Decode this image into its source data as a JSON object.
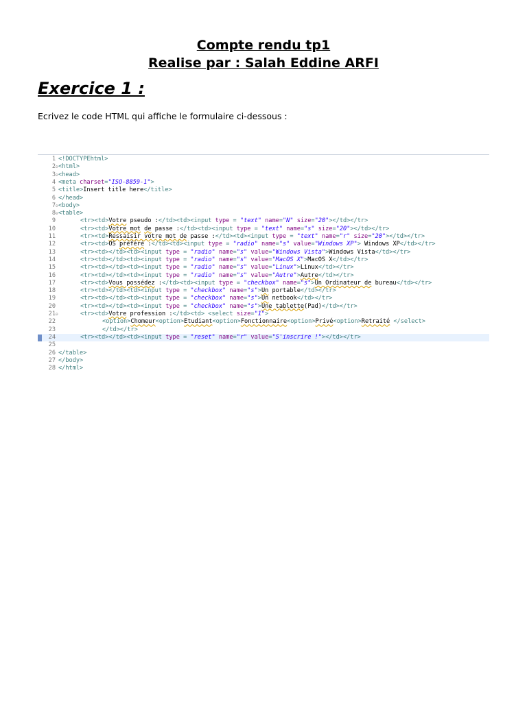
{
  "header": {
    "title_line1": "Compte rendu tp1",
    "title_line2": "Realise par : Salah Eddine ARFI"
  },
  "exercise": {
    "heading": "Exercice 1 :",
    "instruction": "Ecrivez le code HTML qui affiche le formulaire ci-dessous :"
  },
  "code_editor": {
    "current_line": 24,
    "lines": [
      {
        "n": "1",
        "fold": false,
        "indent": 0,
        "tokens": [
          [
            "tag",
            "<!DOCTYPE"
          ],
          [
            "tag",
            "html"
          ],
          [
            "tag",
            ">"
          ]
        ]
      },
      {
        "n": "2",
        "fold": true,
        "indent": 0,
        "tokens": [
          [
            "tag",
            "<html>"
          ]
        ]
      },
      {
        "n": "3",
        "fold": true,
        "indent": 0,
        "tokens": [
          [
            "tag",
            "<head>"
          ]
        ]
      },
      {
        "n": "4",
        "fold": false,
        "indent": 0,
        "tokens": [
          [
            "tag",
            "<meta "
          ],
          [
            "attr",
            "charset"
          ],
          [
            "tag",
            "="
          ],
          [
            "val",
            "\"ISO-8859-1\""
          ],
          [
            "tag",
            ">"
          ]
        ]
      },
      {
        "n": "5",
        "fold": false,
        "indent": 0,
        "tokens": [
          [
            "tag",
            "<title>"
          ],
          [
            "txt",
            "Insert title here"
          ],
          [
            "tag",
            "</title>"
          ]
        ]
      },
      {
        "n": "6",
        "fold": false,
        "indent": 0,
        "tokens": [
          [
            "tag",
            "</head>"
          ]
        ]
      },
      {
        "n": "7",
        "fold": true,
        "indent": 0,
        "tokens": [
          [
            "tag",
            "<body>"
          ]
        ]
      },
      {
        "n": "8",
        "fold": true,
        "indent": 0,
        "tokens": [
          [
            "tag",
            "<table>"
          ]
        ]
      },
      {
        "n": "9",
        "fold": false,
        "indent": 1,
        "tokens": [
          [
            "tag",
            "<tr><td>"
          ],
          [
            "sq",
            "Votre"
          ],
          [
            "txt",
            " pseudo :"
          ],
          [
            "tag",
            "</td><td><input "
          ],
          [
            "attr",
            "type"
          ],
          [
            "tag",
            " = "
          ],
          [
            "val",
            "\"text\""
          ],
          [
            "attr",
            " name"
          ],
          [
            "tag",
            "="
          ],
          [
            "val",
            "\"N\""
          ],
          [
            "attr",
            " size"
          ],
          [
            "tag",
            "="
          ],
          [
            "val",
            "\"20\""
          ],
          [
            "tag",
            "></td></tr>"
          ]
        ]
      },
      {
        "n": "10",
        "fold": false,
        "indent": 1,
        "tokens": [
          [
            "tag",
            "<tr><td>"
          ],
          [
            "sq",
            "Votre mot"
          ],
          [
            "txt",
            " "
          ],
          [
            "sq",
            "de"
          ],
          [
            "txt",
            " passe :"
          ],
          [
            "tag",
            "</td><td><input "
          ],
          [
            "attr",
            "type"
          ],
          [
            "tag",
            " = "
          ],
          [
            "val",
            "\"text\""
          ],
          [
            "attr",
            " name"
          ],
          [
            "tag",
            "="
          ],
          [
            "val",
            "\"s\""
          ],
          [
            "attr",
            " size"
          ],
          [
            "tag",
            "="
          ],
          [
            "val",
            "\"20\""
          ],
          [
            "tag",
            "></td></tr>"
          ]
        ]
      },
      {
        "n": "11",
        "fold": false,
        "indent": 1,
        "tokens": [
          [
            "tag",
            "<tr><td>"
          ],
          [
            "sq",
            "Ressaisir votre mot de"
          ],
          [
            "txt",
            " passe :"
          ],
          [
            "tag",
            "</td><td><input "
          ],
          [
            "attr",
            "type"
          ],
          [
            "tag",
            " = "
          ],
          [
            "val",
            "\"text\""
          ],
          [
            "attr",
            " name"
          ],
          [
            "tag",
            "="
          ],
          [
            "val",
            "\"r\""
          ],
          [
            "attr",
            " size"
          ],
          [
            "tag",
            "="
          ],
          [
            "val",
            "\"20\""
          ],
          [
            "tag",
            "></td></tr>"
          ]
        ]
      },
      {
        "n": "12",
        "fold": false,
        "indent": 1,
        "tokens": [
          [
            "tag",
            "<tr><td>"
          ],
          [
            "txt",
            "OS "
          ],
          [
            "sq",
            "préféré"
          ],
          [
            "txt",
            " :"
          ],
          [
            "tag",
            "</td><td><input "
          ],
          [
            "attr",
            "type"
          ],
          [
            "tag",
            " = "
          ],
          [
            "val",
            "\"radio\""
          ],
          [
            "attr",
            " name"
          ],
          [
            "tag",
            "="
          ],
          [
            "val",
            "\"s\""
          ],
          [
            "attr",
            " value"
          ],
          [
            "tag",
            "="
          ],
          [
            "val",
            "\"Windows XP\""
          ],
          [
            "tag",
            "> "
          ],
          [
            "txt",
            "Windows XP"
          ],
          [
            "tag",
            "</td></tr>"
          ]
        ]
      },
      {
        "n": "13",
        "fold": false,
        "indent": 1,
        "tokens": [
          [
            "tag",
            "<tr><td></td><td><input "
          ],
          [
            "attr",
            "type"
          ],
          [
            "tag",
            " = "
          ],
          [
            "val",
            "\"radio\""
          ],
          [
            "attr",
            " name"
          ],
          [
            "tag",
            "="
          ],
          [
            "val",
            "\"s\""
          ],
          [
            "attr",
            " value"
          ],
          [
            "tag",
            "="
          ],
          [
            "val",
            "\"Windows Vista\""
          ],
          [
            "tag",
            ">"
          ],
          [
            "txt",
            "Windows Vista"
          ],
          [
            "tag",
            "</td></tr>"
          ]
        ]
      },
      {
        "n": "14",
        "fold": false,
        "indent": 1,
        "tokens": [
          [
            "tag",
            "<tr><td></td><td><input "
          ],
          [
            "attr",
            "type"
          ],
          [
            "tag",
            " = "
          ],
          [
            "val",
            "\"radio\""
          ],
          [
            "attr",
            " name"
          ],
          [
            "tag",
            "="
          ],
          [
            "val",
            "\"s\""
          ],
          [
            "attr",
            " value"
          ],
          [
            "tag",
            "="
          ],
          [
            "val",
            "\"MacOS X\""
          ],
          [
            "tag",
            ">"
          ],
          [
            "txt",
            "MacOS X"
          ],
          [
            "tag",
            "</td></tr>"
          ]
        ]
      },
      {
        "n": "15",
        "fold": false,
        "indent": 1,
        "tokens": [
          [
            "tag",
            "<tr><td></td><td><input "
          ],
          [
            "attr",
            "type"
          ],
          [
            "tag",
            " = "
          ],
          [
            "val",
            "\"radio\""
          ],
          [
            "attr",
            " name"
          ],
          [
            "tag",
            "="
          ],
          [
            "val",
            "\"s\""
          ],
          [
            "attr",
            " value"
          ],
          [
            "tag",
            "="
          ],
          [
            "val",
            "\"Linux\""
          ],
          [
            "tag",
            ">"
          ],
          [
            "txt",
            "Linux"
          ],
          [
            "tag",
            "</td></tr>"
          ]
        ]
      },
      {
        "n": "16",
        "fold": false,
        "indent": 1,
        "tokens": [
          [
            "tag",
            "<tr><td></td><td><input "
          ],
          [
            "attr",
            "type"
          ],
          [
            "tag",
            " = "
          ],
          [
            "val",
            "\"radio\""
          ],
          [
            "attr",
            " name"
          ],
          [
            "tag",
            "="
          ],
          [
            "val",
            "\"s\""
          ],
          [
            "attr",
            " value"
          ],
          [
            "tag",
            "="
          ],
          [
            "val",
            "\"Autre\""
          ],
          [
            "tag",
            ">"
          ],
          [
            "sq",
            "Autre"
          ],
          [
            "tag",
            "</td></tr>"
          ]
        ]
      },
      {
        "n": "17",
        "fold": false,
        "indent": 1,
        "tokens": [
          [
            "tag",
            "<tr><td>"
          ],
          [
            "sq",
            "Vous possédez"
          ],
          [
            "txt",
            " :"
          ],
          [
            "tag",
            "</td><td><input "
          ],
          [
            "attr",
            "type"
          ],
          [
            "tag",
            " = "
          ],
          [
            "val",
            "\"checkbox\""
          ],
          [
            "attr",
            " name"
          ],
          [
            "tag",
            "="
          ],
          [
            "val",
            "\"s\""
          ],
          [
            "tag",
            ">"
          ],
          [
            "sq",
            "Un Ordinateur de"
          ],
          [
            "txt",
            " bureau"
          ],
          [
            "tag",
            "</td></tr>"
          ]
        ]
      },
      {
        "n": "18",
        "fold": false,
        "indent": 1,
        "tokens": [
          [
            "tag",
            "<tr><td></td><td><input "
          ],
          [
            "attr",
            "type"
          ],
          [
            "tag",
            " = "
          ],
          [
            "val",
            "\"checkbox\""
          ],
          [
            "attr",
            " name"
          ],
          [
            "tag",
            "="
          ],
          [
            "val",
            "\"s\""
          ],
          [
            "tag",
            ">"
          ],
          [
            "sq",
            "Un"
          ],
          [
            "txt",
            " portable"
          ],
          [
            "tag",
            "</td></tr>"
          ]
        ]
      },
      {
        "n": "19",
        "fold": false,
        "indent": 1,
        "tokens": [
          [
            "tag",
            "<tr><td></td><td><input "
          ],
          [
            "attr",
            "type"
          ],
          [
            "tag",
            " = "
          ],
          [
            "val",
            "\"checkbox\""
          ],
          [
            "attr",
            " name"
          ],
          [
            "tag",
            "="
          ],
          [
            "val",
            "\"s\""
          ],
          [
            "tag",
            ">"
          ],
          [
            "sq",
            "Un"
          ],
          [
            "txt",
            " netbook"
          ],
          [
            "tag",
            "</td></tr>"
          ]
        ]
      },
      {
        "n": "20",
        "fold": false,
        "indent": 1,
        "tokens": [
          [
            "tag",
            "<tr><td></td><td><input "
          ],
          [
            "attr",
            "type"
          ],
          [
            "tag",
            " = "
          ],
          [
            "val",
            "\"checkbox\""
          ],
          [
            "attr",
            " name"
          ],
          [
            "tag",
            "="
          ],
          [
            "val",
            "\"s\""
          ],
          [
            "tag",
            ">"
          ],
          [
            "sq",
            "Une tablette"
          ],
          [
            "txt",
            "(Pad)"
          ],
          [
            "tag",
            "</td></tr>"
          ]
        ]
      },
      {
        "n": "21",
        "fold": true,
        "indent": 1,
        "tokens": [
          [
            "tag",
            "<tr><td>"
          ],
          [
            "sq",
            "Votre"
          ],
          [
            "txt",
            " profession :"
          ],
          [
            "tag",
            "</td><td> <select "
          ],
          [
            "attr",
            "size"
          ],
          [
            "tag",
            "="
          ],
          [
            "val",
            "\"1\""
          ],
          [
            "tag",
            ">"
          ]
        ]
      },
      {
        "n": "22",
        "fold": false,
        "indent": 2,
        "tokens": [
          [
            "tag",
            "<option>"
          ],
          [
            "sq",
            "Chomeur"
          ],
          [
            "tag",
            "<option>"
          ],
          [
            "sq",
            "Etudiant"
          ],
          [
            "tag",
            "<option>"
          ],
          [
            "sq",
            "Fonctionnaire"
          ],
          [
            "tag",
            "<option>"
          ],
          [
            "sq",
            "Privé"
          ],
          [
            "tag",
            "<option>"
          ],
          [
            "sq",
            "Retraité"
          ],
          [
            "tag",
            " </select>"
          ]
        ]
      },
      {
        "n": "23",
        "fold": false,
        "indent": 2,
        "tokens": [
          [
            "tag",
            "</td></tr>"
          ]
        ]
      },
      {
        "n": "24",
        "fold": false,
        "indent": 1,
        "tokens": [
          [
            "tag",
            "<tr><td></td><td><input "
          ],
          [
            "attr",
            "type"
          ],
          [
            "tag",
            " = "
          ],
          [
            "val",
            "\"reset\""
          ],
          [
            "attr",
            " name"
          ],
          [
            "tag",
            "="
          ],
          [
            "val",
            "\"r\""
          ],
          [
            "attr",
            " value"
          ],
          [
            "tag",
            "="
          ],
          [
            "val",
            "\"S'inscrire !\""
          ],
          [
            "tag",
            "></td></tr>"
          ]
        ]
      },
      {
        "n": "25",
        "fold": false,
        "indent": 0,
        "tokens": []
      },
      {
        "n": "26",
        "fold": false,
        "indent": 0,
        "tokens": [
          [
            "tag",
            "</table>"
          ]
        ]
      },
      {
        "n": "27",
        "fold": false,
        "indent": 0,
        "tokens": [
          [
            "tag",
            "</body>"
          ]
        ]
      },
      {
        "n": "28",
        "fold": false,
        "indent": 0,
        "tokens": [
          [
            "tag",
            "</html>"
          ]
        ]
      }
    ]
  }
}
